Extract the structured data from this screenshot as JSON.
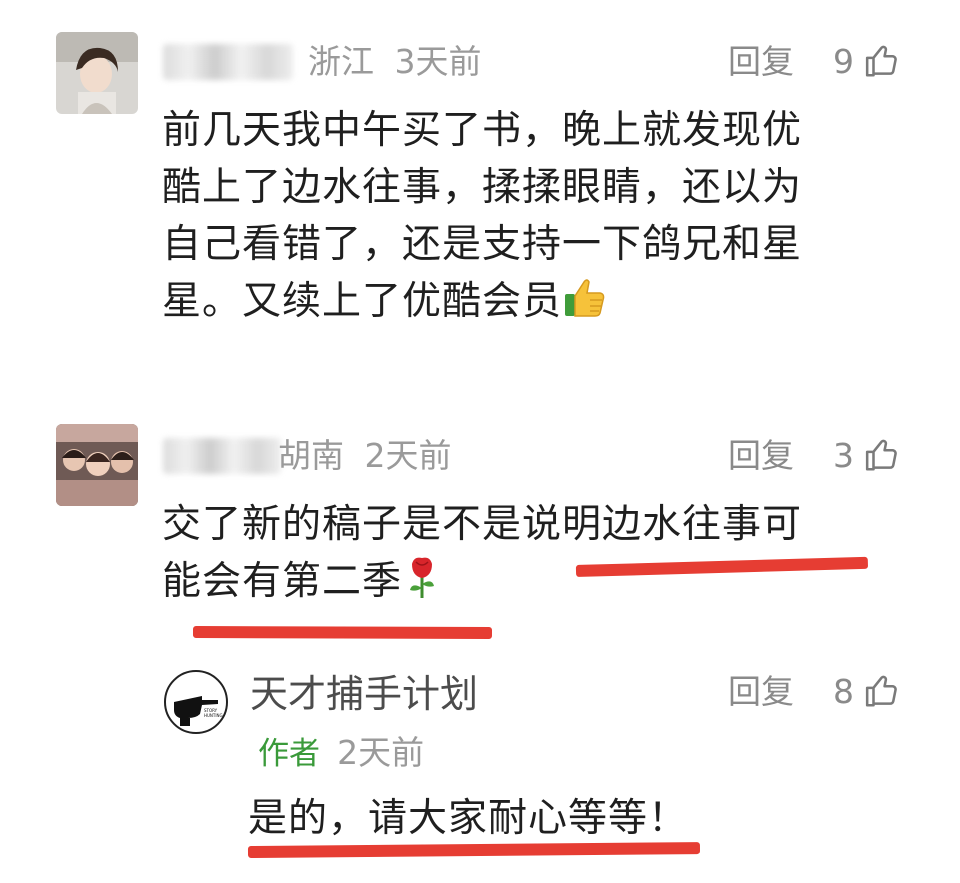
{
  "accent_red": "#e63d33",
  "author_tag_color": "#3a9a3a",
  "comments": [
    {
      "region": "浙江",
      "time": "3天前",
      "reply_label": "回复",
      "likes": "9",
      "lines": [
        "前几天我中午买了书，晚上就发现优",
        "酷上了边水往事，揉揉眼睛，还以为",
        "自己看错了，还是支持一下鸽兄和星",
        "星。又续上了优酷会员"
      ],
      "emoji": "thumbs-up-emoji"
    },
    {
      "region": "湖南",
      "region_visible": "胡南",
      "time": "2天前",
      "reply_label": "回复",
      "likes": "3",
      "lines": [
        "交了新的稿子是不是说明边水往事可",
        "能会有第二季"
      ],
      "emoji": "rose-emoji"
    }
  ],
  "reply": {
    "name": "天才捕手计划",
    "tag": "作者",
    "time": "2天前",
    "reply_label": "回复",
    "likes": "8",
    "text": "是的，请大家耐心等等！",
    "avatar_text": "STORY HUNTING"
  }
}
